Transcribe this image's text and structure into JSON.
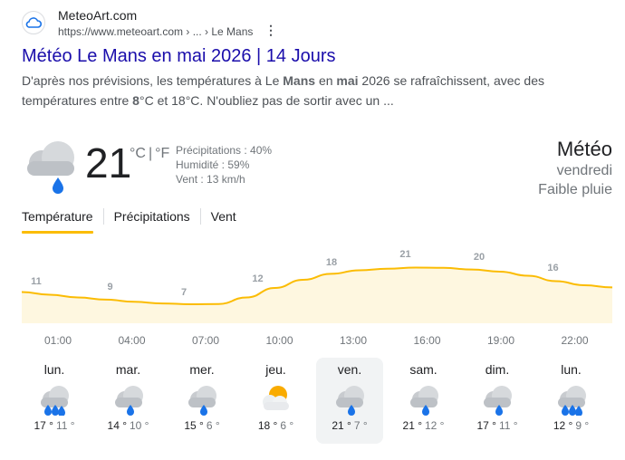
{
  "result": {
    "site_name": "MeteoArt.com",
    "url": "https://www.meteoart.com › ... › Le Mans",
    "title": "Météo Le Mans en mai 2026 | 14 Jours",
    "snippet": {
      "p1": "D'après nos prévisions, les températures à Le ",
      "b1": "Mans",
      "p2": " en ",
      "b2": "mai",
      "p3": " 2026 se rafraîchissent, avec des températures entre ",
      "b3": "8",
      "p4": "°C et 18°C. N'oubliez pas de sortir avec un ..."
    }
  },
  "weather": {
    "current_temp": "21",
    "unit_c": "°C",
    "unit_f": "°F",
    "precip": "Précipitations : 40%",
    "humidity": "Humidité : 59%",
    "wind": "Vent : 13 km/h",
    "heading": "Météo",
    "day": "vendredi",
    "condition": "Faible pluie",
    "tabs": [
      "Température",
      "Précipitations",
      "Vent"
    ],
    "active_tab": 0
  },
  "chart_data": {
    "type": "area",
    "x": [
      "01:00",
      "04:00",
      "07:00",
      "10:00",
      "13:00",
      "16:00",
      "19:00",
      "22:00"
    ],
    "labels": [
      11,
      9,
      7,
      12,
      18,
      21,
      20,
      16
    ],
    "curve": [
      11.5,
      10.5,
      9.5,
      8.7,
      7.9,
      7.3,
      7.0,
      7.1,
      9.5,
      13.0,
      16.0,
      18.2,
      19.5,
      20.1,
      20.5,
      20.4,
      19.8,
      19.0,
      17.5,
      15.5,
      14.0,
      13.2
    ],
    "ylim": [
      0,
      29
    ],
    "color": "#fbbc04",
    "fill": "#fef7e0"
  },
  "days": [
    {
      "name": "lun.",
      "hi": "17 °",
      "lo": "11 °",
      "icon": "rain-icon",
      "selected": false
    },
    {
      "name": "mar.",
      "hi": "14 °",
      "lo": "10 °",
      "icon": "light-rain-icon",
      "selected": false
    },
    {
      "name": "mer.",
      "hi": "15 °",
      "lo": "6 °",
      "icon": "light-rain-icon",
      "selected": false
    },
    {
      "name": "jeu.",
      "hi": "18 °",
      "lo": "6 °",
      "icon": "partly-cloudy-icon",
      "selected": false
    },
    {
      "name": "ven.",
      "hi": "21 °",
      "lo": "7 °",
      "icon": "light-rain-icon",
      "selected": true
    },
    {
      "name": "sam.",
      "hi": "21 °",
      "lo": "12 °",
      "icon": "light-rain-icon",
      "selected": false
    },
    {
      "name": "dim.",
      "hi": "17 °",
      "lo": "11 °",
      "icon": "light-rain-icon",
      "selected": false
    },
    {
      "name": "lun.",
      "hi": "12 °",
      "lo": "9 °",
      "icon": "rain-icon",
      "selected": false
    }
  ],
  "colors": {
    "link": "#1a0dab",
    "accent": "#fbbc04",
    "rain": "#1a73e8"
  }
}
